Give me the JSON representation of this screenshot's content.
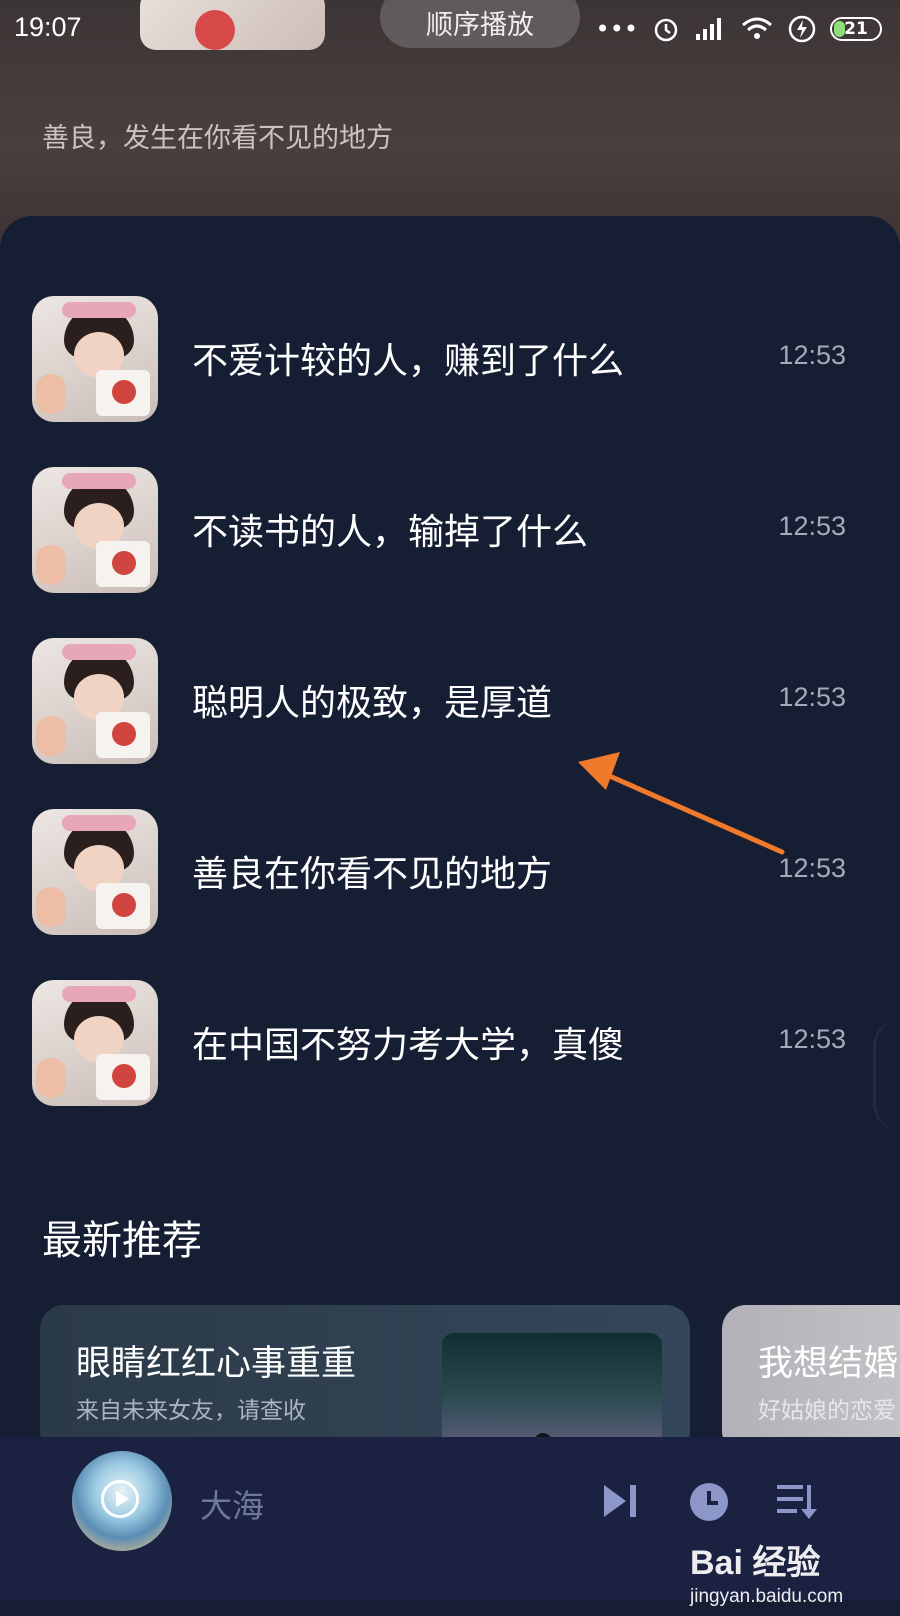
{
  "status_bar": {
    "time": "19:07",
    "more": "•••",
    "battery": "21"
  },
  "header": {
    "order_mode": "顺序播放",
    "subtitle": "善良，发生在你看不见的地方"
  },
  "playlist": [
    {
      "title": "不爱计较的人，赚到了什么",
      "time": "12:53"
    },
    {
      "title": "不读书的人，输掉了什么",
      "time": "12:53"
    },
    {
      "title": "聪明人的极致，是厚道",
      "time": "12:53"
    },
    {
      "title": "善良在你看不见的地方",
      "time": "12:53"
    },
    {
      "title": "在中国不努力考大学，真傻",
      "time": "12:53"
    }
  ],
  "recommend": {
    "section_title": "最新推荐",
    "cards": [
      {
        "title": "眼睛红红心事重重",
        "subtitle": "来自未来女友，请查收"
      },
      {
        "title": "我想结婚",
        "subtitle": "好姑娘的恋爱"
      }
    ]
  },
  "player": {
    "song": "大海"
  },
  "watermark": {
    "brand": "Bai  经验",
    "url": "jingyan.baidu.com"
  },
  "colors": {
    "panel_bg": "#161e33",
    "player_bg": "#1b2140",
    "arrow": "#f07a2c",
    "icon_accent": "#8d96c9"
  }
}
